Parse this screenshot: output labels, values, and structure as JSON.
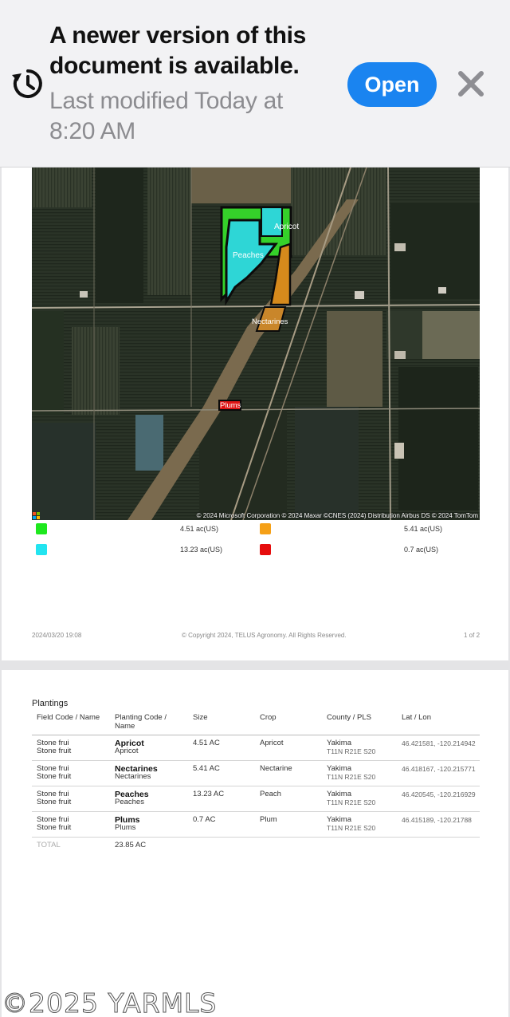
{
  "banner": {
    "title": "A newer version of this document is available.",
    "subtitle": "Last modified Today at 8:20 AM",
    "open_label": "Open",
    "icons": {
      "history": "history-icon",
      "close": "close-icon"
    },
    "accent": "#1a84f0"
  },
  "map": {
    "labels": {
      "apricot": "Apricot",
      "peaches": "Peaches",
      "nectarines": "Nectarines",
      "plums": "Plums"
    },
    "attribution": "© 2024 Microsoft Corporation © 2024 Maxar ©CNES (2024) Distribution Airbus DS © 2024 TomTom",
    "colors": {
      "apricot": "#35d12a",
      "peaches": "#2ed6d6",
      "nectarines": "#d68a1c",
      "plums": "#e01414"
    }
  },
  "legend": [
    {
      "color": "#1ee81e",
      "value": "4.51 ac(US)"
    },
    {
      "color": "#f5a017",
      "value": "5.41 ac(US)"
    },
    {
      "color": "#22e4f0",
      "value": "13.23 ac(US)"
    },
    {
      "color": "#e60d0d",
      "value": "0.7 ac(US)"
    }
  ],
  "footer": {
    "date": "2024/03/20 19:08",
    "copyright": "© Copyright 2024, TELUS Agronomy. All Rights Reserved.",
    "page": "1 of 2"
  },
  "plantings": {
    "title": "Plantings",
    "columns": [
      "Field Code / Name",
      "Planting Code / Name",
      "Size",
      "Crop",
      "County / PLS",
      "Lat / Lon"
    ],
    "rows": [
      {
        "field1": "Stone frui",
        "field2": "Stone fruit",
        "code": "Apricot",
        "name": "Apricot",
        "size": "4.51 AC",
        "crop": "Apricot",
        "county": "Yakima",
        "pls": "T11N R21E S20",
        "latlon": "46.421581, -120.214942"
      },
      {
        "field1": "Stone frui",
        "field2": "Stone fruit",
        "code": "Nectarines",
        "name": "Nectarines",
        "size": "5.41 AC",
        "crop": "Nectarine",
        "county": "Yakima",
        "pls": "T11N R21E S20",
        "latlon": "46.418167, -120.215771"
      },
      {
        "field1": "Stone frui",
        "field2": "Stone fruit",
        "code": "Peaches",
        "name": "Peaches",
        "size": "13.23 AC",
        "crop": "Peach",
        "county": "Yakima",
        "pls": "T11N R21E S20",
        "latlon": "46.420545, -120.216929"
      },
      {
        "field1": "Stone frui",
        "field2": "Stone fruit",
        "code": "Plums",
        "name": "Plums",
        "size": "0.7 AC",
        "crop": "Plum",
        "county": "Yakima",
        "pls": "T11N R21E S20",
        "latlon": "46.415189, -120.21788"
      }
    ],
    "total_label": "TOTAL",
    "total_value": "23.85 AC"
  },
  "watermark": "©2025 YARMLS"
}
